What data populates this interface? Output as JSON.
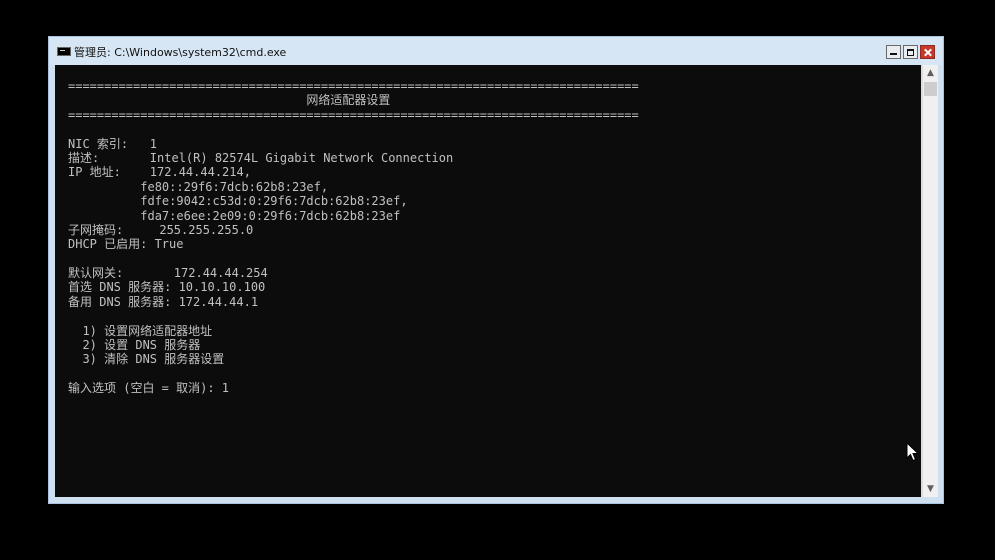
{
  "window": {
    "title": "管理员: C:\\Windows\\system32\\cmd.exe",
    "controls": {
      "minimize": "minimize",
      "maximize": "maximize",
      "close": "close"
    }
  },
  "console": {
    "lines": [
      "===============================================================================",
      "                                 网络适配器设置",
      "===============================================================================",
      "",
      "NIC 索引:   1",
      "描述:       Intel(R) 82574L Gigabit Network Connection",
      "IP 地址:    172.44.44.214,",
      "          fe80::29f6:7dcb:62b8:23ef,",
      "          fdfe:9042:c53d:0:29f6:7dcb:62b8:23ef,",
      "          fda7:e6ee:2e09:0:29f6:7dcb:62b8:23ef",
      "子网掩码:     255.255.255.0",
      "DHCP 已启用: True",
      "",
      "默认网关:       172.44.44.254",
      "首选 DNS 服务器: 10.10.10.100",
      "备用 DNS 服务器: 172.44.44.1",
      "",
      "  1) 设置网络适配器地址",
      "  2) 设置 DNS 服务器",
      "  3) 清除 DNS 服务器设置",
      "",
      "输入选项 (空白 = 取消): 1"
    ]
  },
  "scrollbar": {
    "up_arrow": "▲",
    "down_arrow": "▼"
  },
  "colors": {
    "console_bg": "#0c0c0c",
    "console_text": "#c0c0c0",
    "titlebar": "#d7e6f4",
    "close_button": "#c7382b"
  }
}
